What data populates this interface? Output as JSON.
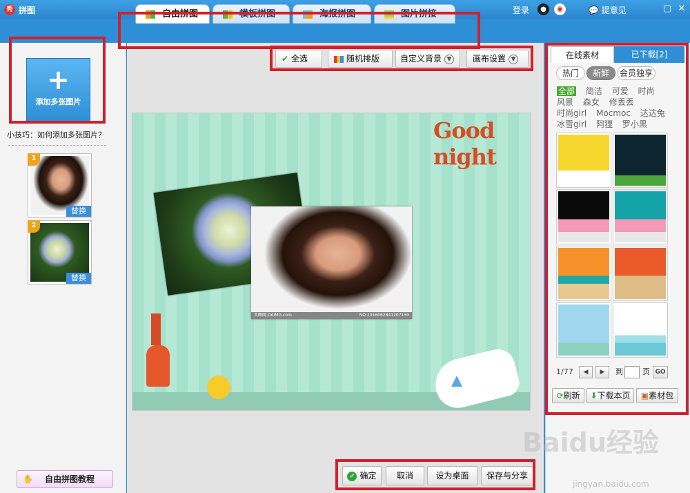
{
  "window": {
    "title": "拼图",
    "app_icon": "秀",
    "login": "登录",
    "feedback": "提意见"
  },
  "tabs": [
    {
      "label": "自由拼图",
      "active": true
    },
    {
      "label": "模板拼图",
      "active": false
    },
    {
      "label": "海报拼图",
      "active": false
    },
    {
      "label": "图片拼接",
      "active": false
    }
  ],
  "toolbar": {
    "select_all": "全选",
    "random_layout": "随机排版",
    "custom_bg": "自定义背景",
    "canvas_settings": "画布设置"
  },
  "left": {
    "add_label": "添加多张图片",
    "tip": "小技巧：如何添加多张图片？",
    "thumbs": [
      {
        "num": "1",
        "replace": "替换"
      },
      {
        "num": "2",
        "replace": "替换"
      }
    ],
    "tutorial": "自由拼图教程"
  },
  "canvas": {
    "text": "Good night",
    "photo_caption_left": "大图网 DAIMG.com",
    "photo_caption_right": "NO:20160628412071​59"
  },
  "bottom": {
    "confirm": "确定",
    "cancel": "取消",
    "set_desktop": "设为桌面",
    "save_share": "保存与分享"
  },
  "right": {
    "tab_online": "在线素材",
    "tab_downloaded": "已下载[2]",
    "chips": [
      "热门",
      "新鲜",
      "会员独享"
    ],
    "tags": [
      [
        "全部",
        "简洁",
        "可爱",
        "时尚"
      ],
      [
        "风景",
        "森女",
        "修丢丢"
      ],
      [
        "时尚girl",
        "Mocmoc",
        "达达兔"
      ],
      [
        "冰雪girl",
        "阿狸",
        "罗小黑"
      ]
    ],
    "page": "1/77",
    "goto": "到",
    "page_unit": "页",
    "go": "GO",
    "refresh": "刷新",
    "download_page": "下载本页",
    "pack": "素材包"
  },
  "watermark": {
    "logo": "Baidu经验",
    "url": "jingyan.baidu.com"
  },
  "colors": {
    "brand_blue": "#2f8fd6",
    "highlight_red": "#d1202c",
    "canvas_green": "#a6e1cd"
  }
}
